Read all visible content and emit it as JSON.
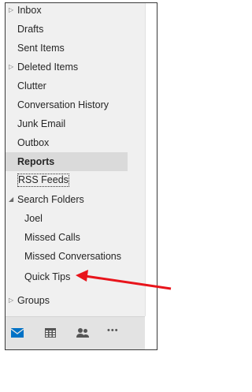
{
  "folders": [
    {
      "label": "Inbox",
      "expander": "▷"
    },
    {
      "label": "Drafts"
    },
    {
      "label": "Sent Items"
    },
    {
      "label": "Deleted Items",
      "expander": "▷"
    },
    {
      "label": "Clutter"
    },
    {
      "label": "Conversation History"
    },
    {
      "label": "Junk Email"
    },
    {
      "label": "Outbox"
    },
    {
      "label": "Reports"
    },
    {
      "label": "RSS Feeds"
    },
    {
      "label": "Search Folders",
      "expander": "◢"
    },
    {
      "label": "Joel"
    },
    {
      "label": "Missed Calls"
    },
    {
      "label": "Missed Conversations"
    },
    {
      "label": "Quick Tips"
    },
    {
      "label": ""
    },
    {
      "label": "Groups",
      "expander": "▷"
    }
  ],
  "nav": {
    "mail_icon": "mail-icon",
    "calendar_icon": "calendar-icon",
    "people_icon": "people-icon",
    "more_icon": "more-icon",
    "more_glyph": "•••"
  },
  "colors": {
    "accent": "#0072c6",
    "selected_bg": "#dadada",
    "pane_bg": "#f0f0f0",
    "navbar_bg": "#e3e3e3",
    "arrow": "#e8141b"
  }
}
